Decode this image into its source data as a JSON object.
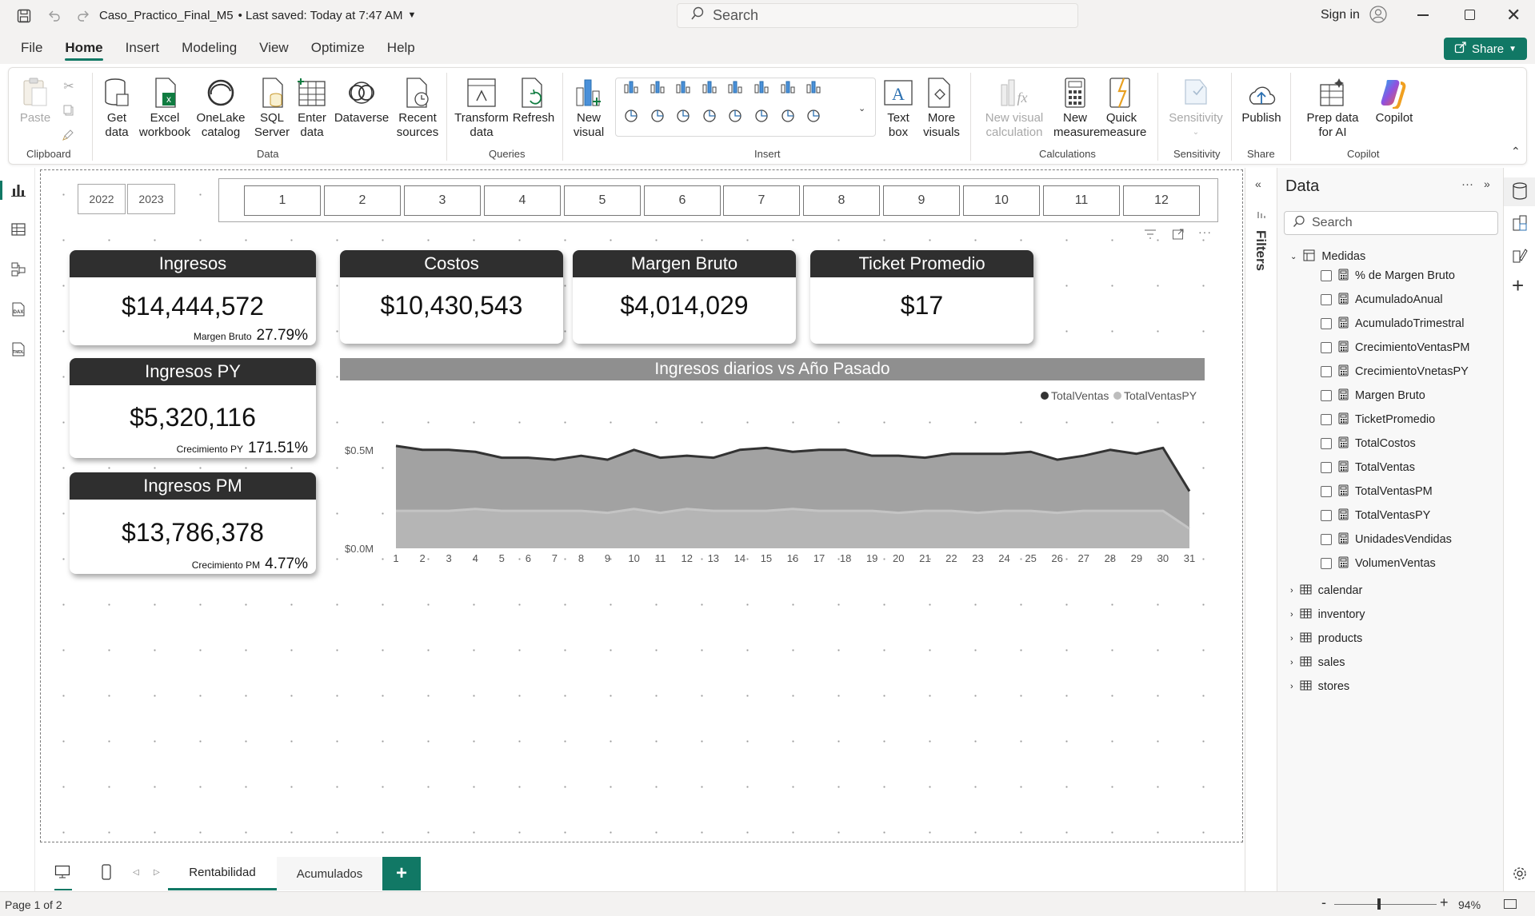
{
  "titlebar": {
    "file_name": "Caso_Practico_Final_M5",
    "saved": "• Last saved: Today at 7:47 AM",
    "search_placeholder": "Search",
    "sign_in": "Sign in"
  },
  "menu": {
    "tabs": [
      "File",
      "Home",
      "Insert",
      "Modeling",
      "View",
      "Optimize",
      "Help"
    ],
    "active": "Home",
    "share": "Share"
  },
  "ribbon": {
    "clipboard": {
      "paste": "Paste",
      "group": "Clipboard"
    },
    "data": {
      "get_data": "Get data",
      "excel": "Excel workbook",
      "onelake": "OneLake catalog",
      "sql": "SQL Server",
      "enter": "Enter data",
      "dataverse": "Dataverse",
      "recent": "Recent sources",
      "group": "Data"
    },
    "queries": {
      "transform": "Transform data",
      "refresh": "Refresh",
      "group": "Queries"
    },
    "insert": {
      "new_visual": "New visual",
      "text_box": "Text box",
      "more_visuals": "More visuals",
      "group": "Insert"
    },
    "calculations": {
      "new_visual_calc": "New visual calculation",
      "new_measure": "New measure",
      "quick_measure": "Quick measure",
      "group": "Calculations"
    },
    "sensitivity": {
      "label": "Sensitivity",
      "group": "Sensitivity"
    },
    "share": {
      "publish": "Publish",
      "group": "Share"
    },
    "copilot": {
      "prep": "Prep data for AI",
      "copilot": "Copilot",
      "group": "Copilot"
    }
  },
  "slicers": {
    "years": [
      "2022",
      "2023"
    ],
    "months": [
      "1",
      "2",
      "3",
      "4",
      "5",
      "6",
      "7",
      "8",
      "9",
      "10",
      "11",
      "12"
    ]
  },
  "cards": {
    "ingresos": {
      "title": "Ingresos",
      "value": "$14,444,572",
      "sub_label": "Margen Bruto",
      "sub_value": "27.79%"
    },
    "costos": {
      "title": "Costos",
      "value": "$10,430,543"
    },
    "margen": {
      "title": "Margen Bruto",
      "value": "$4,014,029"
    },
    "ticket": {
      "title": "Ticket Promedio",
      "value": "$17"
    },
    "ingresos_py": {
      "title": "Ingresos PY",
      "value": "$5,320,116",
      "sub_label": "Crecimiento PY",
      "sub_value": "171.51%"
    },
    "ingresos_pm": {
      "title": "Ingresos PM",
      "value": "$13,786,378",
      "sub_label": "Crecimiento PM",
      "sub_value": "4.77%"
    }
  },
  "chart_data": {
    "type": "area",
    "title": "Ingresos diarios vs Año Pasado",
    "x": [
      1,
      2,
      3,
      4,
      5,
      6,
      7,
      8,
      9,
      10,
      11,
      12,
      13,
      14,
      15,
      16,
      17,
      18,
      19,
      20,
      21,
      22,
      23,
      24,
      25,
      26,
      27,
      28,
      29,
      30,
      31
    ],
    "series": [
      {
        "name": "TotalVentas",
        "color": "#333333",
        "values": [
          0.52,
          0.5,
          0.5,
          0.49,
          0.46,
          0.46,
          0.45,
          0.47,
          0.45,
          0.5,
          0.46,
          0.47,
          0.46,
          0.5,
          0.51,
          0.49,
          0.5,
          0.5,
          0.47,
          0.47,
          0.46,
          0.48,
          0.48,
          0.48,
          0.49,
          0.45,
          0.47,
          0.5,
          0.48,
          0.51,
          0.29
        ]
      },
      {
        "name": "TotalVentasPY",
        "color": "#bdbdbd",
        "values": [
          0.19,
          0.19,
          0.19,
          0.2,
          0.19,
          0.19,
          0.19,
          0.19,
          0.18,
          0.2,
          0.18,
          0.2,
          0.19,
          0.19,
          0.19,
          0.2,
          0.19,
          0.19,
          0.19,
          0.18,
          0.19,
          0.19,
          0.18,
          0.19,
          0.19,
          0.18,
          0.19,
          0.19,
          0.19,
          0.19,
          0.1
        ]
      }
    ],
    "yticks": [
      "$0.0M",
      "$0.5M"
    ],
    "ylim": [
      0,
      0.56
    ],
    "legend": "top-right",
    "grid": false
  },
  "datapane": {
    "title": "Data",
    "search_placeholder": "Search",
    "folder": "Medidas",
    "measures": [
      "% de Margen Bruto",
      "AcumuladoAnual",
      "AcumuladoTrimestral",
      "CrecimientoVentasPM",
      "CrecimientoVnetasPY",
      "Margen Bruto",
      "TicketPromedio",
      "TotalCostos",
      "TotalVentas",
      "TotalVentasPM",
      "TotalVentasPY",
      "UnidadesVendidas",
      "VolumenVentas"
    ],
    "tables": [
      "calendar",
      "inventory",
      "products",
      "sales",
      "stores"
    ],
    "filters_label": "Filters"
  },
  "pages": {
    "tabs": [
      "Rentabilidad",
      "Acumulados"
    ],
    "active": "Rentabilidad",
    "add": "+"
  },
  "status": {
    "page": "Page 1 of 2",
    "zoom": "94%"
  }
}
